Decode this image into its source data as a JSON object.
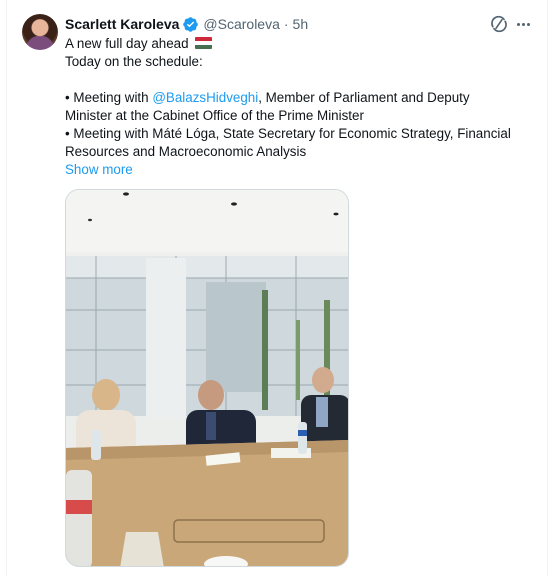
{
  "tweet": {
    "author_name": "Scarlett Karoleva",
    "handle": "@Scaroleva",
    "separator": "·",
    "time": "5h",
    "lines": [
      "A new full day ahead",
      "Today on the schedule:",
      "",
      "• Meeting with ",
      "@BalazsHidveghi",
      ", Member of Parliament and Deputy",
      "Minister at the Cabinet Office of the Prime Minister",
      "• Meeting with Máté Lóga, State Secretary for Economic Strategy, Financial",
      "Resources and Macroeconomic Analysis"
    ],
    "show_more": "Show more"
  },
  "icons": {
    "verified": "verified-badge-icon",
    "flag": "hungary-flag-emoji",
    "grok": "grok-icon",
    "more": "more-options-icon"
  },
  "colors": {
    "accent": "#1d9bf0",
    "text": "#0f1419",
    "secondary": "#536471",
    "flag_red": "#ce2939",
    "flag_white": "#ffffff",
    "flag_green": "#477050"
  }
}
